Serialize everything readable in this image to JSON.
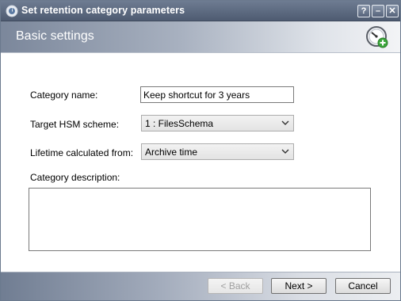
{
  "window": {
    "title": "Set retention category parameters",
    "controls": {
      "help": "?",
      "minimize": "–",
      "close": "✕"
    }
  },
  "banner": {
    "title": "Basic settings",
    "icon": "gauge-add-icon"
  },
  "form": {
    "category_name": {
      "label": "Category name:",
      "value": "Keep shortcut for 3 years"
    },
    "target_hsm": {
      "label": "Target HSM scheme:",
      "selected": "1 : FilesSchema"
    },
    "lifetime": {
      "label": "Lifetime calculated from:",
      "selected": "Archive time"
    },
    "description": {
      "label": "Category description:",
      "value": ""
    }
  },
  "footer": {
    "back_label": "< Back",
    "next_label": "Next >",
    "cancel_label": "Cancel"
  },
  "colors": {
    "title_bar": "#56637a",
    "banner_left": "#7b879b",
    "accent_green": "#3aa63a"
  }
}
